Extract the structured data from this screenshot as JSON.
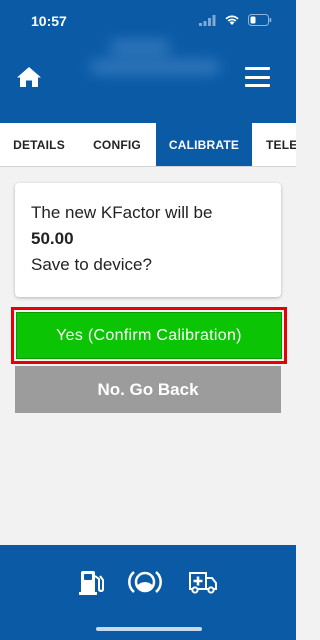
{
  "status_bar": {
    "time": "10:57"
  },
  "header": {
    "home_icon": "home-icon",
    "menu_icon": "hamburger-menu-icon"
  },
  "tabs": [
    {
      "label": "DETAILS",
      "active": false
    },
    {
      "label": "CONFIG",
      "active": false
    },
    {
      "label": "CALIBRATE",
      "active": true
    },
    {
      "label": "TELE",
      "active": false
    }
  ],
  "dialog": {
    "line1": "The new KFactor will be",
    "value": "50.00",
    "line3": "Save to device?"
  },
  "buttons": {
    "confirm_label": "Yes (Confirm Calibration)",
    "back_label": "No. Go Back"
  },
  "bottom_nav": {
    "icons": [
      "fuel-pump-icon",
      "gauge-icon",
      "ambulance-icon"
    ]
  },
  "colors": {
    "primary": "#0a5aa6",
    "confirm": "#0bc403",
    "highlight": "#e60000",
    "back": "#9c9c9c"
  }
}
